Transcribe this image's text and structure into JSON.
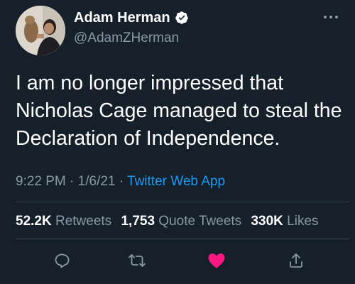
{
  "author": {
    "display_name": "Adam Herman",
    "handle": "@AdamZHerman",
    "verified": true
  },
  "tweet": {
    "text": "I am no longer impressed that Nicholas Cage managed to steal the Declaration of Independence.",
    "time": "9:22 PM",
    "separator": "·",
    "date": "1/6/21",
    "source": "Twitter Web App"
  },
  "stats": {
    "retweets": {
      "count": "52.2K",
      "label": "Retweets"
    },
    "quote_tweets": {
      "count": "1,753",
      "label": "Quote Tweets"
    },
    "likes": {
      "count": "330K",
      "label": "Likes"
    }
  },
  "actions": {
    "liked": true
  },
  "colors": {
    "background": "#15202b",
    "text_primary": "#ffffff",
    "text_secondary": "#8b98a5",
    "link": "#1d9bf0",
    "like": "#f91880",
    "divider": "#38444d"
  }
}
